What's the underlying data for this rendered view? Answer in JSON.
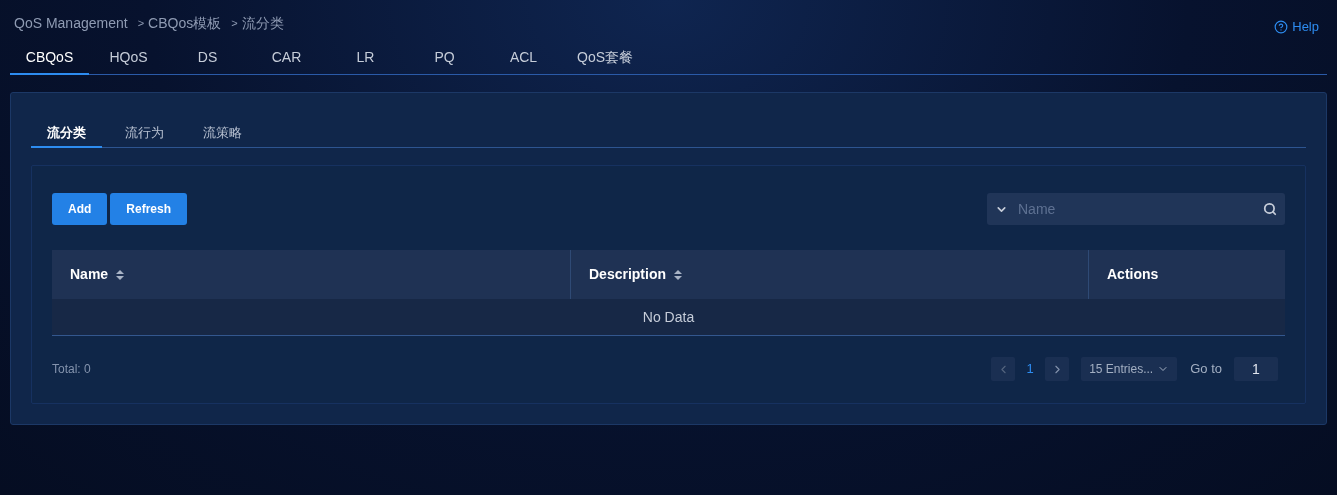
{
  "breadcrumb": [
    {
      "label": "QoS Management"
    },
    {
      "separator": ">",
      "label": "CBQos模板"
    },
    {
      "separator": ">",
      "label": "流分类"
    }
  ],
  "help": {
    "label": "Help"
  },
  "tabs": [
    {
      "label": "CBQoS",
      "selected": true
    },
    {
      "label": "HQoS",
      "selected": false
    },
    {
      "label": "DS",
      "selected": false
    },
    {
      "label": "CAR",
      "selected": false
    },
    {
      "label": "LR",
      "selected": false
    },
    {
      "label": "PQ",
      "selected": false
    },
    {
      "label": "ACL",
      "selected": false
    },
    {
      "label": "QoS套餐",
      "selected": false
    }
  ],
  "subtabs": [
    {
      "label": "流分类",
      "selected": true
    },
    {
      "label": "流行为",
      "selected": false
    },
    {
      "label": "流策略",
      "selected": false
    }
  ],
  "buttons": [
    {
      "label": "Add"
    },
    {
      "label": "Refresh"
    }
  ],
  "search": {
    "placeholder": "Name"
  },
  "table": {
    "columns": [
      {
        "label": "Name",
        "sortable": true
      },
      {
        "label": "Description",
        "sortable": true
      },
      {
        "label": "Actions",
        "sortable": false
      }
    ],
    "empty_text": "No Data"
  },
  "footer": {
    "total": "Total: 0",
    "pages": [
      {
        "label": "1",
        "selected": true
      }
    ],
    "page_size": "15 Entries...",
    "goto_label": "Go to",
    "goto_value": "1"
  }
}
